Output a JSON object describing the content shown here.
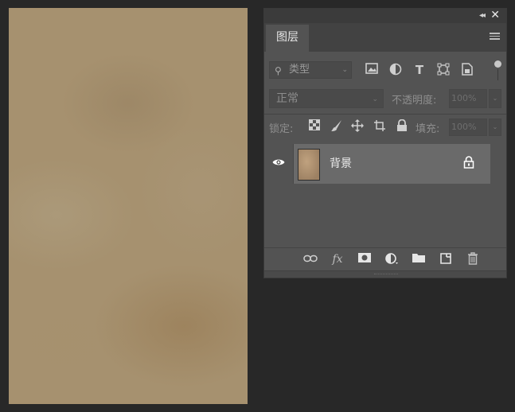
{
  "panel": {
    "tab_label": "图层",
    "filter": {
      "kind_label": "类型"
    },
    "blend_mode": "正常",
    "opacity_label": "不透明度:",
    "opacity_value": "100%",
    "lock_label": "锁定:",
    "fill_label": "填充:",
    "fill_value": "100%",
    "layers": [
      {
        "name": "背景",
        "visible": true,
        "locked": true
      }
    ]
  },
  "icons": {
    "collapse": "double-chevron-left-icon",
    "close": "close-icon",
    "menu": "hamburger-menu-icon"
  }
}
